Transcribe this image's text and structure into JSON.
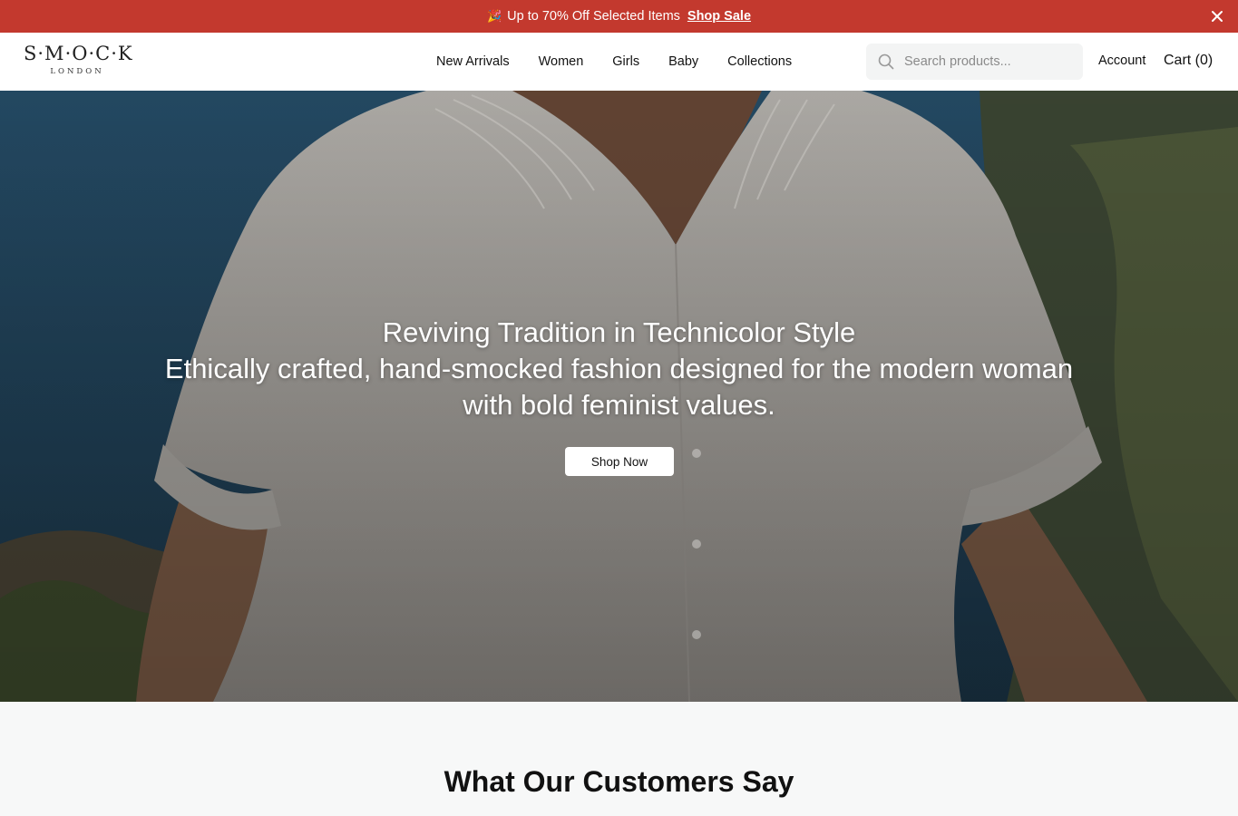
{
  "announcement": {
    "icon": "party-popper-icon",
    "message": "Up to 70% Off Selected Items",
    "link_label": "Shop Sale",
    "background": "#c3392e"
  },
  "header": {
    "logo": {
      "main": "S·M·O·C·K",
      "sub": "LONDON"
    },
    "nav": [
      {
        "label": "New Arrivals"
      },
      {
        "label": "Women"
      },
      {
        "label": "Girls"
      },
      {
        "label": "Baby"
      },
      {
        "label": "Collections"
      }
    ],
    "search": {
      "placeholder": "Search products...",
      "icon": "search-icon"
    },
    "account_label": "Account",
    "cart_label": "Cart (0)"
  },
  "hero": {
    "title": "Reviving Tradition in Technicolor Style",
    "subtitle": "Ethically crafted, hand-smocked fashion designed for the modern woman with bold feminist values.",
    "button_label": "Shop Now"
  },
  "testimonials": {
    "heading": "What Our Customers Say"
  }
}
